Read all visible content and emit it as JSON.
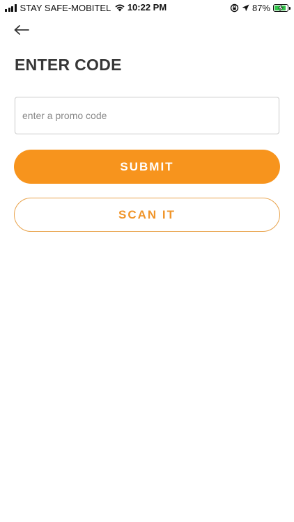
{
  "status_bar": {
    "carrier": "STAY SAFE-MOBITEL",
    "time": "10:22 PM",
    "battery_percent_label": "87%",
    "battery_level": 0.87,
    "icons": [
      "signal-icon",
      "wifi-icon",
      "screen-rotation-lock-icon",
      "location-arrow-icon",
      "battery-charging-icon"
    ]
  },
  "header": {
    "back_icon": "arrow-left-icon",
    "title": "ENTER CODE"
  },
  "form": {
    "promo_input": {
      "value": "",
      "placeholder": "enter a promo code"
    },
    "submit_label": "SUBMIT",
    "scan_label": "SCAN IT"
  },
  "colors": {
    "accent": "#f7941d",
    "scan_text": "#f0952a",
    "scan_border": "#e8a24a",
    "title": "#373737",
    "input_border": "#c9c9c9",
    "battery_fill": "#32c34a"
  }
}
